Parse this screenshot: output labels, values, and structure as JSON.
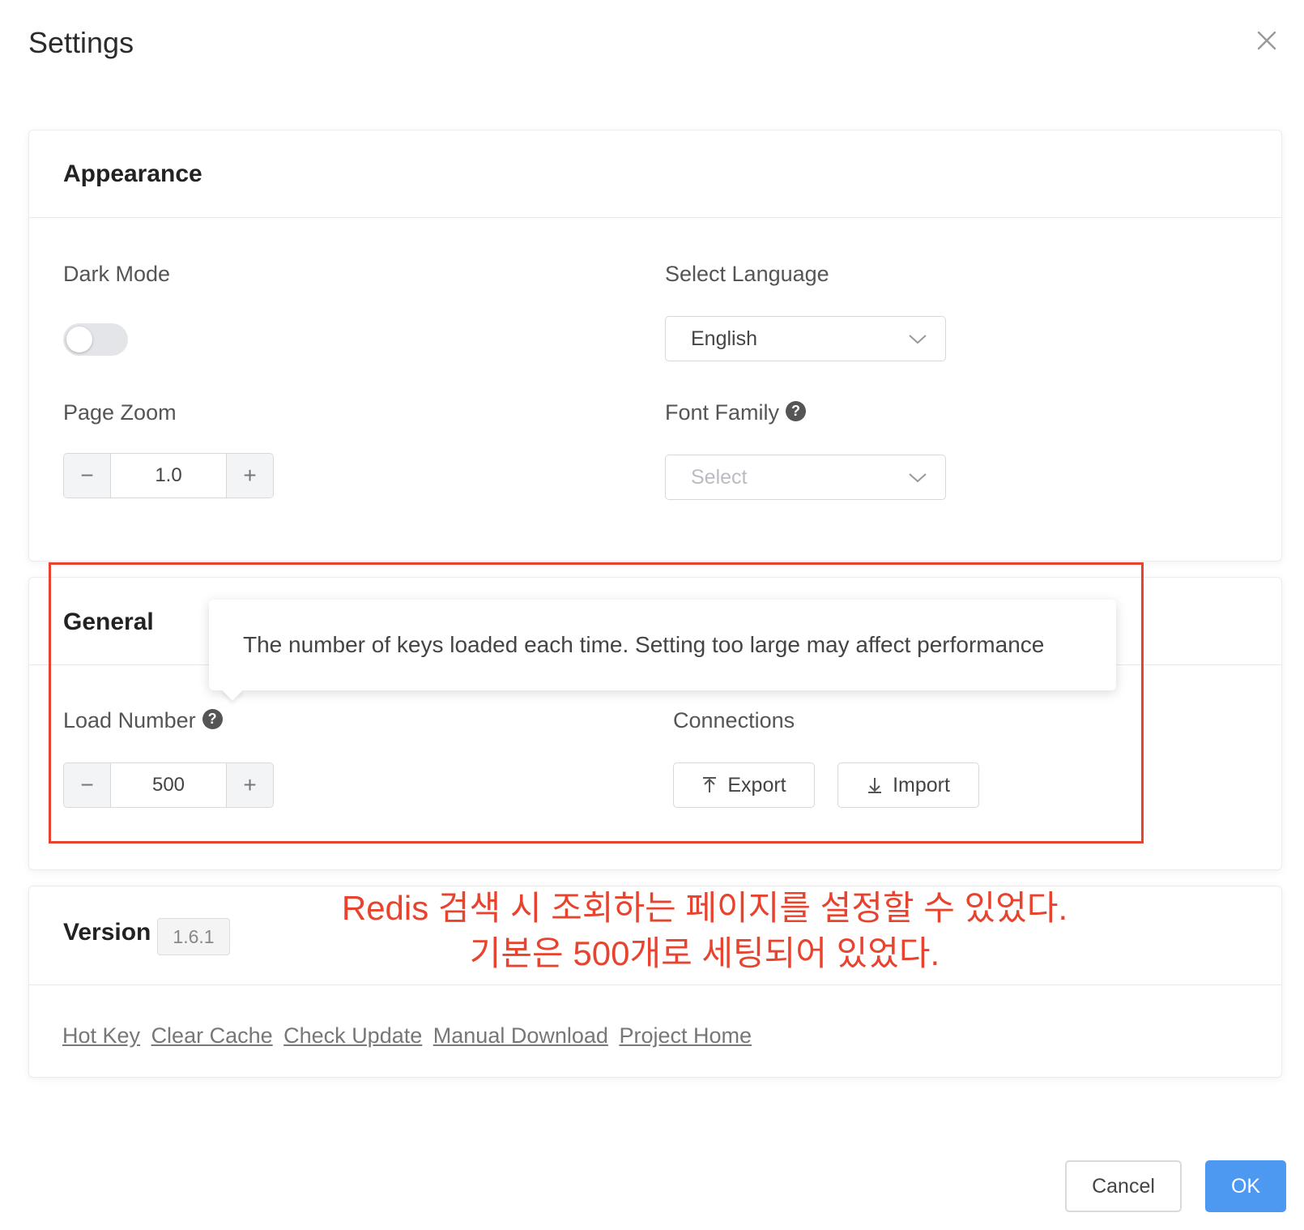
{
  "dialog": {
    "title": "Settings"
  },
  "appearance": {
    "title": "Appearance",
    "dark_mode_label": "Dark Mode",
    "dark_mode_on": false,
    "page_zoom_label": "Page Zoom",
    "page_zoom_value": "1.0",
    "minus_symbol": "−",
    "plus_symbol": "+",
    "language_label": "Select Language",
    "language_value": "English",
    "font_family_label": "Font Family",
    "font_family_placeholder": "Select",
    "help_symbol": "?"
  },
  "general": {
    "title": "General",
    "load_number_label": "Load Number",
    "load_number_value": "500",
    "connections_label": "Connections",
    "export_label": "Export",
    "import_label": "Import",
    "tooltip_text": "The number of keys loaded each time. Setting too large may affect performance"
  },
  "version": {
    "title": "Version",
    "badge": "1.6.1",
    "links": [
      "Hot Key",
      "Clear Cache",
      "Check Update",
      "Manual Download",
      "Project Home"
    ]
  },
  "annotation": {
    "line1": "Redis 검색 시 조회하는 페이지를 설정할 수 있었다.",
    "line2": "기본은 500개로 세팅되어 있었다.",
    "color": "#e8432e"
  },
  "footer": {
    "cancel_label": "Cancel",
    "ok_label": "OK"
  },
  "colors": {
    "primary": "#4d98f0",
    "highlight": "#e8432e"
  },
  "icons": [
    "close-icon",
    "help-icon",
    "chevron-down-icon",
    "upload-icon",
    "download-icon"
  ]
}
